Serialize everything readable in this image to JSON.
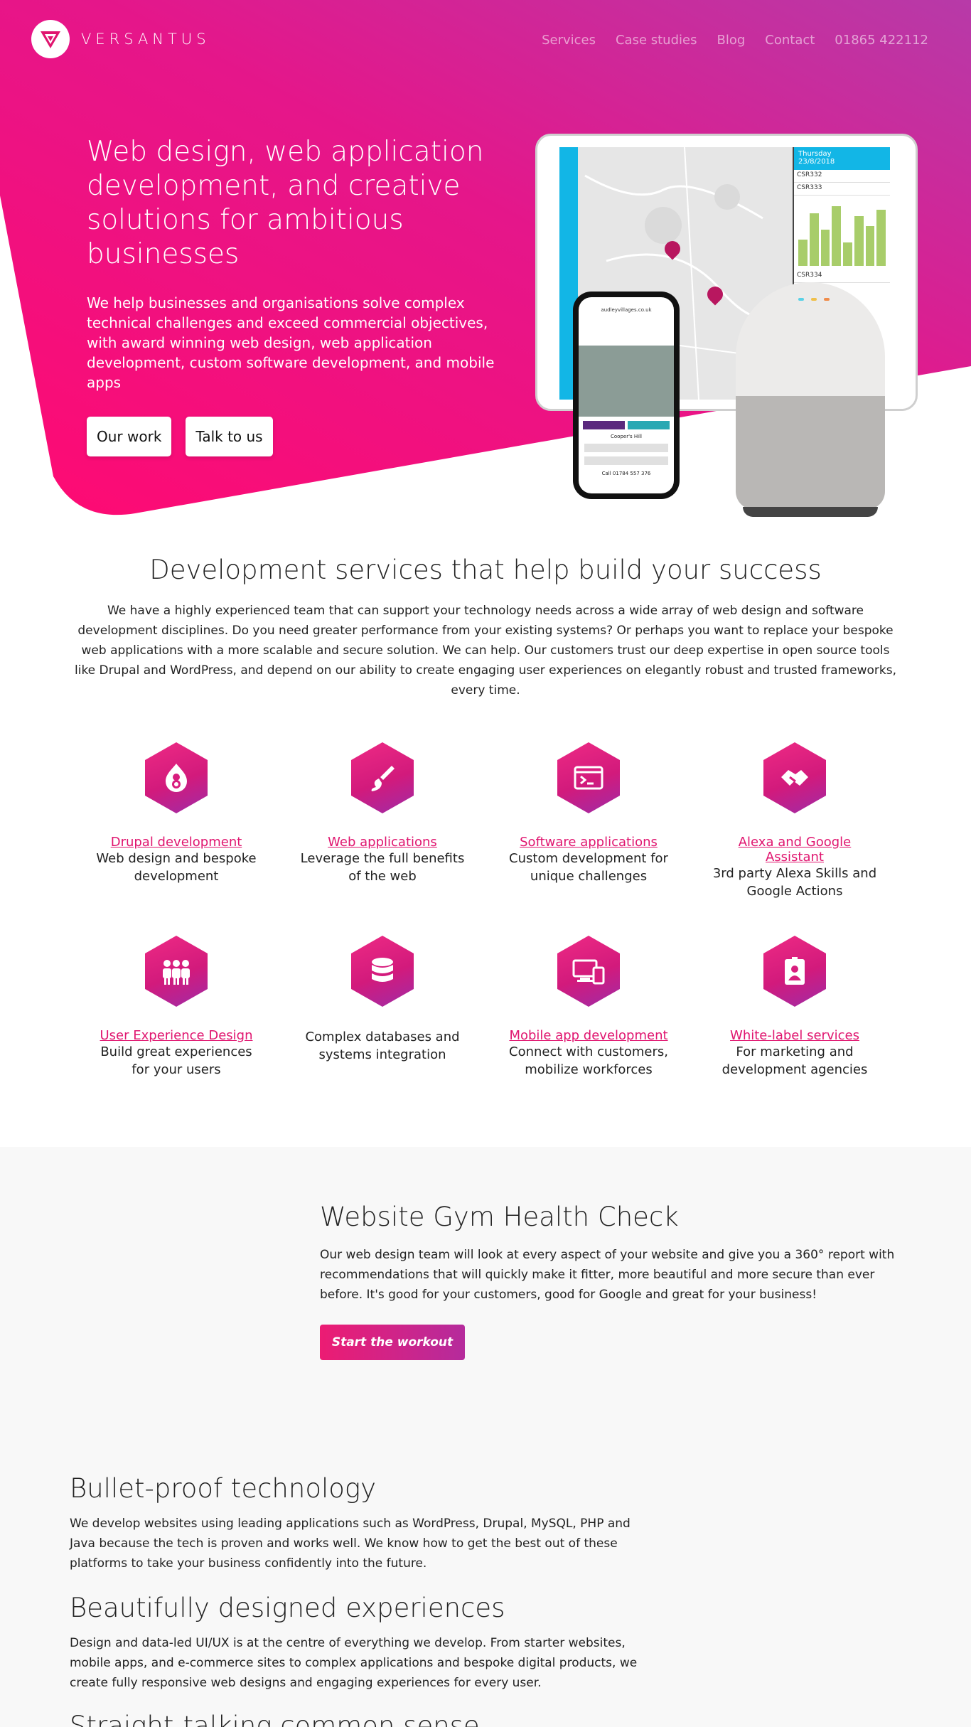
{
  "brand": {
    "name": "VERSANTUS"
  },
  "nav": {
    "items": [
      "Services",
      "Case studies",
      "Blog",
      "Contact",
      "01865 422112"
    ]
  },
  "hero": {
    "title": "Web design, web application development, and creative solutions for ambitious businesses",
    "subtitle": "We help businesses and organisations solve complex technical challenges and exceed commercial objectives, with award winning web design, web application development, custom software development, and mobile apps",
    "btn_work": "Our work",
    "btn_talk": "Talk to us"
  },
  "devices": {
    "tablet_day": "Thursday",
    "tablet_date": "23/8/2018",
    "rows": [
      "CSR332",
      "CSR333",
      "CSR334"
    ],
    "phone_url": "audleyvillages.co.uk",
    "phone_title": "Cooper's Hill",
    "phone_call": "Call 01784 557 376"
  },
  "services": {
    "title": "Development services that help build your success",
    "text": "We have a highly experienced team that can support your technology needs across a wide array of web design and software development disciplines. Do you need greater performance from your existing systems? Or perhaps you want to replace your bespoke web applications with a more scalable and secure solution. We can help. Our customers trust our deep expertise in open source tools like Drupal and WordPress, and depend on our ability to create engaging user experiences on elegantly robust and trusted frameworks, every time.",
    "cards": [
      {
        "icon": "drupal-icon",
        "link": "Drupal development",
        "text": "Web design and bespoke development"
      },
      {
        "icon": "brush-icon",
        "link": "Web applications",
        "text": "Leverage the full benefits of the web"
      },
      {
        "icon": "terminal-icon",
        "link": "Software applications",
        "text": "Custom development for unique challenges"
      },
      {
        "icon": "handshake-icon",
        "link": "Alexa and Google Assistant",
        "text": "3rd party Alexa Skills and Google Actions"
      },
      {
        "icon": "users-icon",
        "link": "User Experience Design",
        "text": "Build great experiences for your users"
      },
      {
        "icon": "database-icon",
        "link": "",
        "text": "Complex databases and systems integration"
      },
      {
        "icon": "devices-icon",
        "link": "Mobile app development",
        "text": "Connect with customers, mobilize workforces"
      },
      {
        "icon": "id-badge-icon",
        "link": "White-label services",
        "text": "For marketing and development agencies"
      }
    ]
  },
  "gym": {
    "title": "Website Gym Health Check",
    "text": "Our web design team will look at every aspect of your website and give you a 360° report with recommendations that will quickly make it fitter, more beautiful and more secure than ever before. It's good for your customers, good for Google and great for your business!",
    "button": "Start the workout"
  },
  "features": [
    {
      "title": "Bullet-proof technology",
      "text": "We develop websites using leading applications such as WordPress, Drupal, MySQL, PHP and Java because the tech is proven and works well. We know how to get the best out of these platforms to take your business confidently into the future."
    },
    {
      "title": "Beautifully designed experiences",
      "text": "Design and data-led UI/UX is at the centre of everything we develop. From starter websites, mobile apps, and e-commerce sites to complex applications and bespoke digital products, we create fully responsive web designs and engaging experiences for every user."
    },
    {
      "title": "Straight-talking common sense",
      "text": ""
    }
  ],
  "colors": {
    "pink": "#ff0a7a",
    "purple": "#b73aa8",
    "link": "#e0156f"
  }
}
